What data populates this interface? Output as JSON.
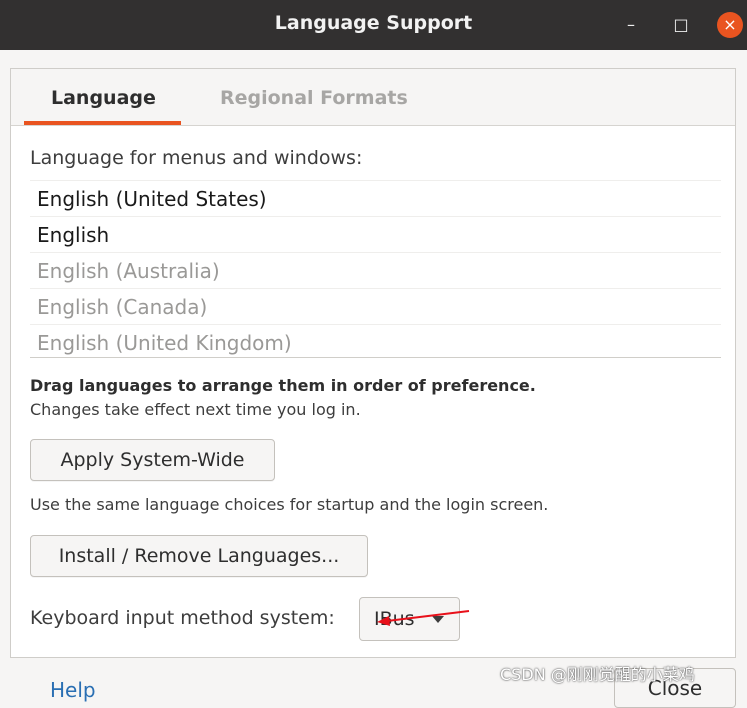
{
  "window": {
    "title": "Language Support",
    "controls": {
      "minimize": "–",
      "maximize": "□",
      "close": "×"
    }
  },
  "tabs": [
    {
      "label": "Language",
      "active": true
    },
    {
      "label": "Regional Formats",
      "active": false
    }
  ],
  "language_section": {
    "label": "Language for menus and windows:",
    "items": [
      {
        "label": "English (United States)",
        "enabled": true
      },
      {
        "label": "English",
        "enabled": true
      },
      {
        "label": "English (Australia)",
        "enabled": false
      },
      {
        "label": "English (Canada)",
        "enabled": false
      },
      {
        "label": "English (United Kingdom)",
        "enabled": false
      }
    ],
    "drag_hint": "Drag languages to arrange them in order of preference.",
    "effect_hint": "Changes take effect next time you log in."
  },
  "buttons": {
    "apply": "Apply System-Wide",
    "apply_note": "Use the same language choices for startup and the login screen.",
    "install": "Install / Remove Languages..."
  },
  "keyboard": {
    "label": "Keyboard input method system:",
    "selected": "IBus"
  },
  "footer": {
    "help": "Help",
    "close": "Close"
  },
  "watermark": "CSDN @刚刚觉醒的小菜鸡",
  "colors": {
    "accent": "#e95420",
    "titlebar": "#323030",
    "annotation_arrow": "#e8101a"
  }
}
